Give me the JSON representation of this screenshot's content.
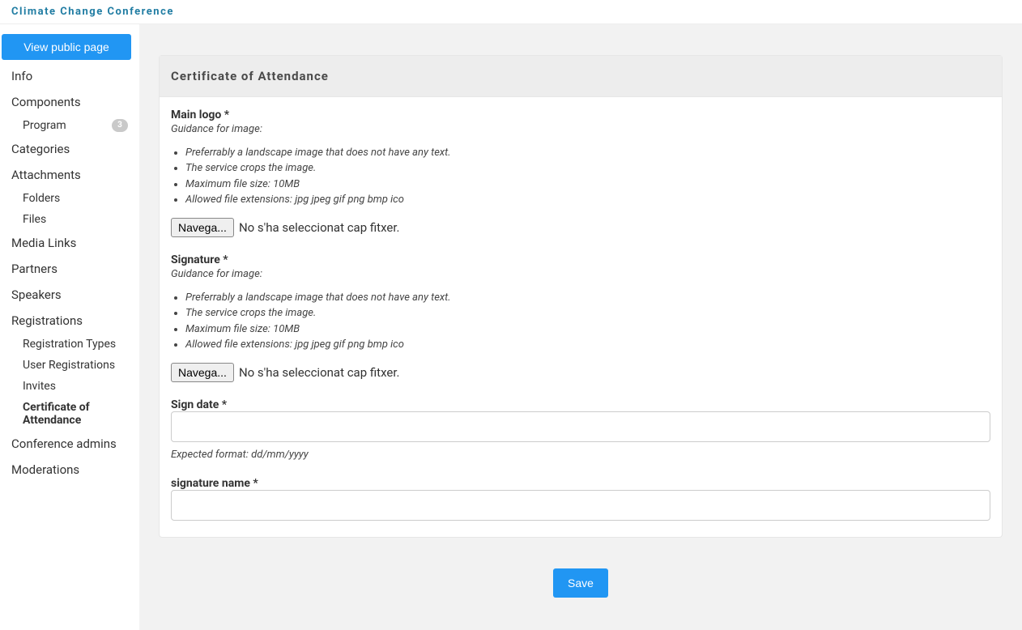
{
  "topbar": {
    "brand": "Climate Change Conference"
  },
  "sidebar": {
    "view_public_page": "View public page",
    "items": {
      "info": "Info",
      "components": {
        "label": "Components",
        "program": {
          "label": "Program",
          "badge": "3"
        }
      },
      "categories": "Categories",
      "attachments": {
        "label": "Attachments",
        "folders": "Folders",
        "files": "Files"
      },
      "media_links": "Media Links",
      "partners": "Partners",
      "speakers": "Speakers",
      "registrations": {
        "label": "Registrations",
        "registration_types": "Registration Types",
        "user_registrations": "User Registrations",
        "invites": "Invites",
        "certificate_of_attendance": "Certificate of Attendance"
      },
      "conference_admins": "Conference admins",
      "moderations": "Moderations"
    }
  },
  "panel": {
    "title": "Certificate of Attendance",
    "main_logo": {
      "label": "Main logo",
      "guidance_title": "Guidance for image:",
      "guidance": [
        "Preferrably a landscape image that does not have any text.",
        "The service crops the image.",
        "Maximum file size: 10MB",
        "Allowed file extensions: jpg jpeg gif png bmp ico"
      ],
      "browse_label": "Navega...",
      "no_file": "No s'ha seleccionat cap fitxer."
    },
    "signature": {
      "label": "Signature",
      "guidance_title": "Guidance for image:",
      "guidance": [
        "Preferrably a landscape image that does not have any text.",
        "The service crops the image.",
        "Maximum file size: 10MB",
        "Allowed file extensions: jpg jpeg gif png bmp ico"
      ],
      "browse_label": "Navega...",
      "no_file": "No s'ha seleccionat cap fitxer."
    },
    "sign_date": {
      "label": "Sign date",
      "value": "",
      "help": "Expected format: dd/mm/yyyy"
    },
    "signature_name": {
      "label": "signature name",
      "value": ""
    },
    "save_label": "Save"
  }
}
